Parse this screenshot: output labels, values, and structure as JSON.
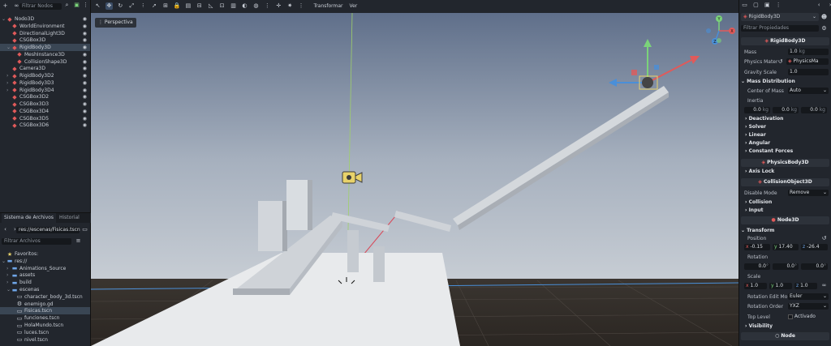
{
  "scene": {
    "filter_placeholder": "Filtrar Nodos",
    "items": [
      {
        "label": "Nodo3D",
        "indent": 0,
        "color": "#e05a5a",
        "icon": "node3d-icon",
        "selected": false
      },
      {
        "label": "WorldEnvironment",
        "indent": 1,
        "color": "#e05a5a",
        "icon": "world-environment-icon",
        "selected": false
      },
      {
        "label": "DirectionalLight3D",
        "indent": 1,
        "color": "#e05a5a",
        "icon": "directional-light-icon",
        "selected": false
      },
      {
        "label": "CSGBox3D",
        "indent": 1,
        "color": "#e05a5a",
        "icon": "csg-box-icon",
        "selected": false
      },
      {
        "label": "RigidBody3D",
        "indent": 1,
        "color": "#e05a5a",
        "icon": "rigidbody-icon",
        "selected": true
      },
      {
        "label": "MeshInstance3D",
        "indent": 2,
        "color": "#e05a5a",
        "icon": "mesh-instance-icon",
        "selected": false
      },
      {
        "label": "CollisionShape3D",
        "indent": 2,
        "color": "#e05a5a",
        "icon": "collision-shape-icon",
        "selected": false
      },
      {
        "label": "Camera3D",
        "indent": 1,
        "color": "#e05a5a",
        "icon": "camera-icon",
        "selected": false
      },
      {
        "label": "RigidBody3D2",
        "indent": 1,
        "color": "#e05a5a",
        "icon": "rigidbody-icon",
        "selected": false
      },
      {
        "label": "RigidBody3D3",
        "indent": 1,
        "color": "#e05a5a",
        "icon": "rigidbody-icon",
        "selected": false
      },
      {
        "label": "RigidBody3D4",
        "indent": 1,
        "color": "#e05a5a",
        "icon": "rigidbody-icon",
        "selected": false
      },
      {
        "label": "CSGBox3D2",
        "indent": 1,
        "color": "#e05a5a",
        "icon": "csg-box-icon",
        "selected": false
      },
      {
        "label": "CSGBox3D3",
        "indent": 1,
        "color": "#e05a5a",
        "icon": "csg-box-icon",
        "selected": false
      },
      {
        "label": "CSGBox3D4",
        "indent": 1,
        "color": "#e05a5a",
        "icon": "csg-box-icon",
        "selected": false
      },
      {
        "label": "CSGBox3D5",
        "indent": 1,
        "color": "#e05a5a",
        "icon": "csg-box-icon",
        "selected": false
      },
      {
        "label": "CSGBox3D6",
        "indent": 1,
        "color": "#e05a5a",
        "icon": "csg-box-icon",
        "selected": false
      }
    ]
  },
  "filesystem": {
    "tab_active": "Sistema de Archivos",
    "tab_other": "Historial",
    "path": "res://escenas/Fisicas.tscn",
    "filter_placeholder": "Filtrar Archivos",
    "items": [
      {
        "label": "Favoritos:",
        "indent": 0,
        "icon": "star-icon",
        "selected": false
      },
      {
        "label": "res://",
        "indent": 0,
        "icon": "folder-icon",
        "selected": false
      },
      {
        "label": "Animations_Source",
        "indent": 1,
        "icon": "folder-icon",
        "selected": false
      },
      {
        "label": "assets",
        "indent": 1,
        "icon": "folder-icon",
        "selected": false
      },
      {
        "label": "build",
        "indent": 1,
        "icon": "folder-icon",
        "selected": false
      },
      {
        "label": "escenas",
        "indent": 1,
        "icon": "folder-icon",
        "selected": false
      },
      {
        "label": "character_body_3d.tscn",
        "indent": 2,
        "icon": "scene-file-icon",
        "selected": false
      },
      {
        "label": "enemigo.gd",
        "indent": 2,
        "icon": "gear-file-icon",
        "selected": false
      },
      {
        "label": "Fisicas.tscn",
        "indent": 2,
        "icon": "scene-file-icon",
        "selected": true
      },
      {
        "label": "funciones.tscn",
        "indent": 2,
        "icon": "scene-file-icon",
        "selected": false
      },
      {
        "label": "HolaMundo.tscn",
        "indent": 2,
        "icon": "scene-file-icon",
        "selected": false
      },
      {
        "label": "luces.tscn",
        "indent": 2,
        "icon": "scene-file-icon",
        "selected": false
      },
      {
        "label": "nivel.tscn",
        "indent": 2,
        "icon": "scene-file-icon",
        "selected": false
      }
    ]
  },
  "toolbar": {
    "transform_menu": "Transformar",
    "view_menu": "Ver"
  },
  "viewport": {
    "perspective_label": "Perspectiva",
    "gizmo": {
      "x": "X",
      "y": "Y",
      "z": "Z"
    }
  },
  "inspector": {
    "node_name": "RigidBody3D",
    "filter_placeholder": "Filtrar Propiedades",
    "class_header": "RigidBody3D",
    "mass_label": "Mass",
    "mass_value": "1.0",
    "mass_unit": "kg",
    "physics_material_label": "Physics Mater",
    "physics_material_value": "PhysicsMa",
    "gravity_label": "Gravity Scale",
    "gravity_value": "1.0",
    "mass_distribution": "Mass Distribution",
    "center_of_mass_label": "Center of Mass",
    "center_of_mass_value": "Auto",
    "inertia_label": "Inertia",
    "inertia": {
      "x": "0.0",
      "y": "0.0",
      "z": "0.0",
      "unit": "kg"
    },
    "sections1": [
      "Deactivation",
      "Solver",
      "Linear",
      "Angular",
      "Constant Forces"
    ],
    "physicsbody_header": "PhysicsBody3D",
    "axis_lock": "Axis Lock",
    "collisionobject_header": "CollisionObject3D",
    "disable_mode_label": "Disable Mode",
    "disable_mode_value": "Remove",
    "collision": "Collision",
    "input": "Input",
    "node3d_header": "Node3D",
    "transform": "Transform",
    "position_label": "Position",
    "position": {
      "x": "-0.15",
      "y": "17.40",
      "z": "-26.4"
    },
    "rotation_label": "Rotation",
    "rotation": {
      "x": "0.0",
      "y": "0.0",
      "z": "0.0",
      "unit": "°"
    },
    "scale_label": "Scale",
    "scale": {
      "x": "1.0",
      "y": "1.0",
      "z": "1.0"
    },
    "rotation_edit_label": "Rotation Edit Mo",
    "rotation_edit_value": "Euler",
    "rotation_order_label": "Rotation Order",
    "rotation_order_value": "YXZ",
    "top_level_label": "Top Level",
    "top_level_value": "Activado",
    "visibility": "Visibility",
    "node_header": "Node"
  },
  "colors": {
    "accent_red": "#e05a5a",
    "accent_blue": "#6fa6e8",
    "selection": "#3a4654",
    "panel": "#22262d"
  }
}
